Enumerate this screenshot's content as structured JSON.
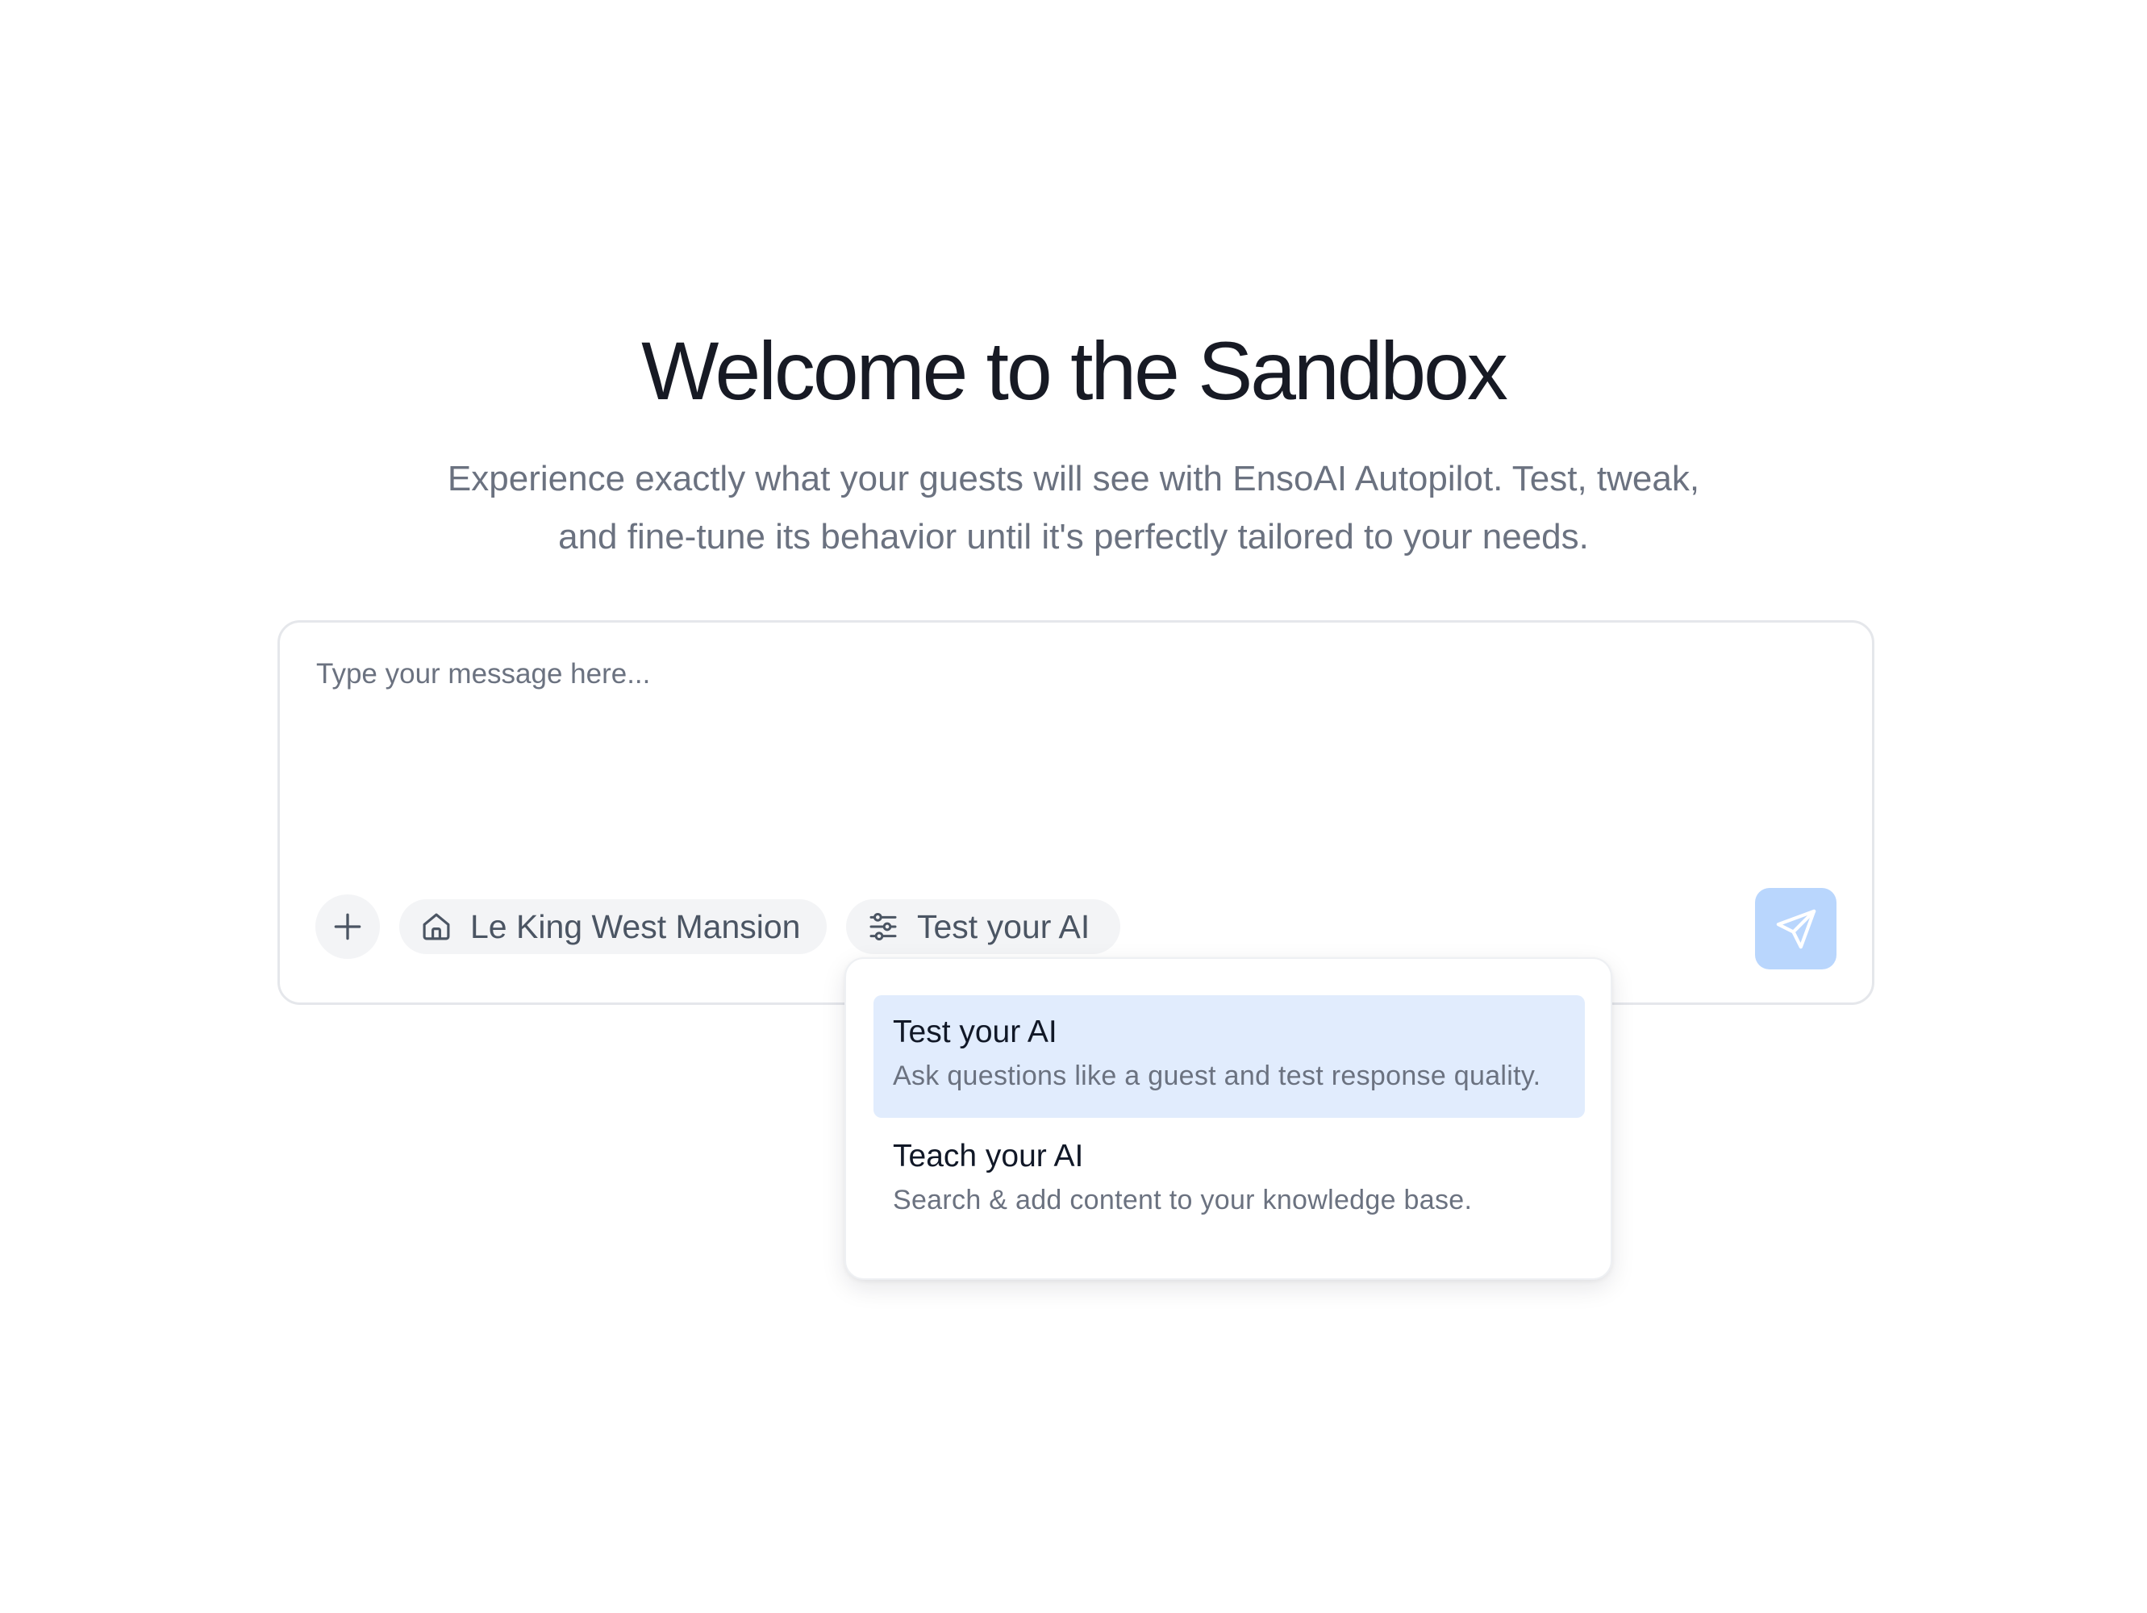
{
  "hero": {
    "title": "Welcome to the Sandbox",
    "subtitle_line1": "Experience exactly what your guests will see with EnsoAI Autopilot. Test, tweak,",
    "subtitle_line2": "and fine-tune its behavior until it's perfectly tailored to your needs."
  },
  "composer": {
    "placeholder": "Type your message here...",
    "value": "",
    "add_icon": "plus-icon",
    "property_chip": {
      "icon": "home-icon",
      "label": "Le King West Mansion"
    },
    "mode_chip": {
      "icon": "sliders-icon",
      "label": "Test your AI"
    },
    "send_icon": "send-icon"
  },
  "mode_menu": {
    "items": [
      {
        "title": "Test your AI",
        "description": "Ask questions like a guest and test response quality.",
        "selected": true
      },
      {
        "title": "Teach your AI",
        "description": "Search & add content to your knowledge base.",
        "selected": false
      }
    ]
  },
  "colors": {
    "title_text": "#171a24",
    "muted_text": "#6b7280",
    "chip_bg": "#f3f4f6",
    "send_button_bg": "#b9d6fd",
    "selected_item_bg": "#e1ecfd",
    "border": "#e5e7eb"
  }
}
